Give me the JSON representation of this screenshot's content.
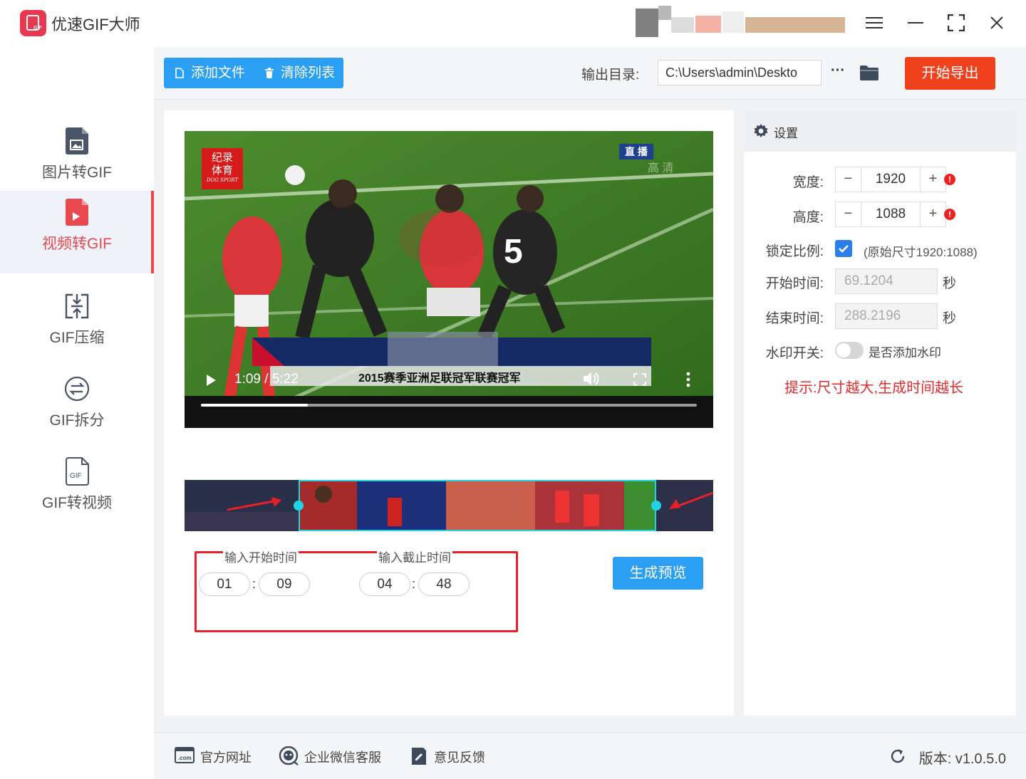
{
  "app": {
    "title": "优速GIF大师",
    "logo_text": "GIF"
  },
  "sidebar": {
    "items": [
      {
        "label": "图片转GIF",
        "active": false
      },
      {
        "label": "视频转GIF",
        "active": true
      },
      {
        "label": "GIF压缩",
        "active": false
      },
      {
        "label": "GIF拆分",
        "active": false
      },
      {
        "label": "GIF转视频",
        "active": false
      }
    ]
  },
  "toolbar": {
    "add_file": "添加文件",
    "clear_list": "清除列表",
    "output_label": "输出目录:",
    "output_path": "C:\\Users\\admin\\Deskto",
    "more": "···",
    "export": "开始导出"
  },
  "video": {
    "logo_line1": "纪录",
    "logo_line2": "体育",
    "logo_sub": "DOG SPORT",
    "live_tag": "直 播",
    "hd_tag": "高 清",
    "current_time": "1:09",
    "duration": "5:22",
    "progress": 0.216,
    "caption": "2015赛季亚洲足联冠军联赛冠军"
  },
  "timeline": {
    "start_fraction": 0.215,
    "end_fraction": 0.892
  },
  "time_inputs": {
    "start_label": "输入开始时间",
    "end_label": "输入截止时间",
    "start_min": "01",
    "start_sec": "09",
    "end_min": "04",
    "end_sec": "48",
    "separator": ":"
  },
  "preview_button": "生成预览",
  "settings": {
    "title": "设置",
    "width_label": "宽度:",
    "width_value": "1920",
    "height_label": "高度:",
    "height_value": "1088",
    "lock_label": "锁定比例:",
    "lock_checked": true,
    "lock_note": "(原始尺寸1920:1088)",
    "start_label": "开始时间:",
    "start_value": "69.1204",
    "end_label": "结束时间:",
    "end_value": "288.2196",
    "seconds_unit": "秒",
    "watermark_label": "水印开关:",
    "watermark_note": "是否添加水印",
    "watermark_on": false,
    "tip": "提示:尺寸越大,生成时间越长",
    "minus": "−",
    "plus": "+",
    "warn": "!"
  },
  "footer": {
    "website": "官方网址",
    "website_icon_text": ".com",
    "wechat": "企业微信客服",
    "feedback": "意见反馈",
    "version": "版本: v1.0.5.0"
  },
  "colors": {
    "accent_blue": "#2b9ff4",
    "export_red": "#f0411d",
    "active_red": "#e8484e",
    "tip_red": "#e42b2b"
  }
}
